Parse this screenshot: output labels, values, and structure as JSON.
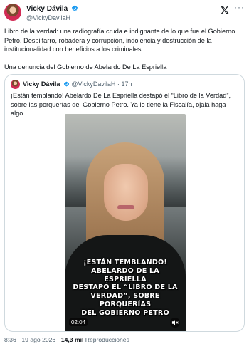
{
  "author": {
    "name": "Vicky Dávila",
    "handle": "@VickyDavilaH"
  },
  "tweet": {
    "paragraph_1": "Libro de la verdad: una radiografía cruda e indignante de lo que fue el Gobierno Petro. Despilfarro, robadera y corrupción, indolencia y destrucción de la institucionalidad con beneficios a los criminales.",
    "paragraph_2": "Una denuncia del Gobierno de Abelardo De La Espriella"
  },
  "quoted": {
    "name": "Vicky Dávila",
    "handle": "@VickyDavilaH",
    "separator": "·",
    "time": "17h",
    "text": "¡Están temblando! Abelardo De La Espriella destapó el “Libro de la Verdad”, sobre las porquerías del Gobierno Petro. Ya lo tiene la Fiscalía, ojalá haga algo.",
    "video": {
      "caption_lines": [
        "¡ESTÁN TEMBLANDO!",
        "ABELARDO DE LA ESPRIELLA",
        "DESTAPÓ EL “LIBRO DE LA",
        "VERDAD”, SOBRE PORQUERÍAS",
        "DEL GOBIERNO PETRO"
      ],
      "duration": "02:04"
    }
  },
  "footer": {
    "time": "8:36",
    "separator": "·",
    "date": "19 ago 2026",
    "views_count": "14,3 mil",
    "views_label": "Reproducciones"
  },
  "colors": {
    "verified": "#1d9bf0",
    "secondary_text": "#536471",
    "border": "#cfd9de"
  },
  "icons": [
    "verified-badge-icon",
    "x-logo-icon",
    "more-options-icon",
    "mute-icon"
  ]
}
